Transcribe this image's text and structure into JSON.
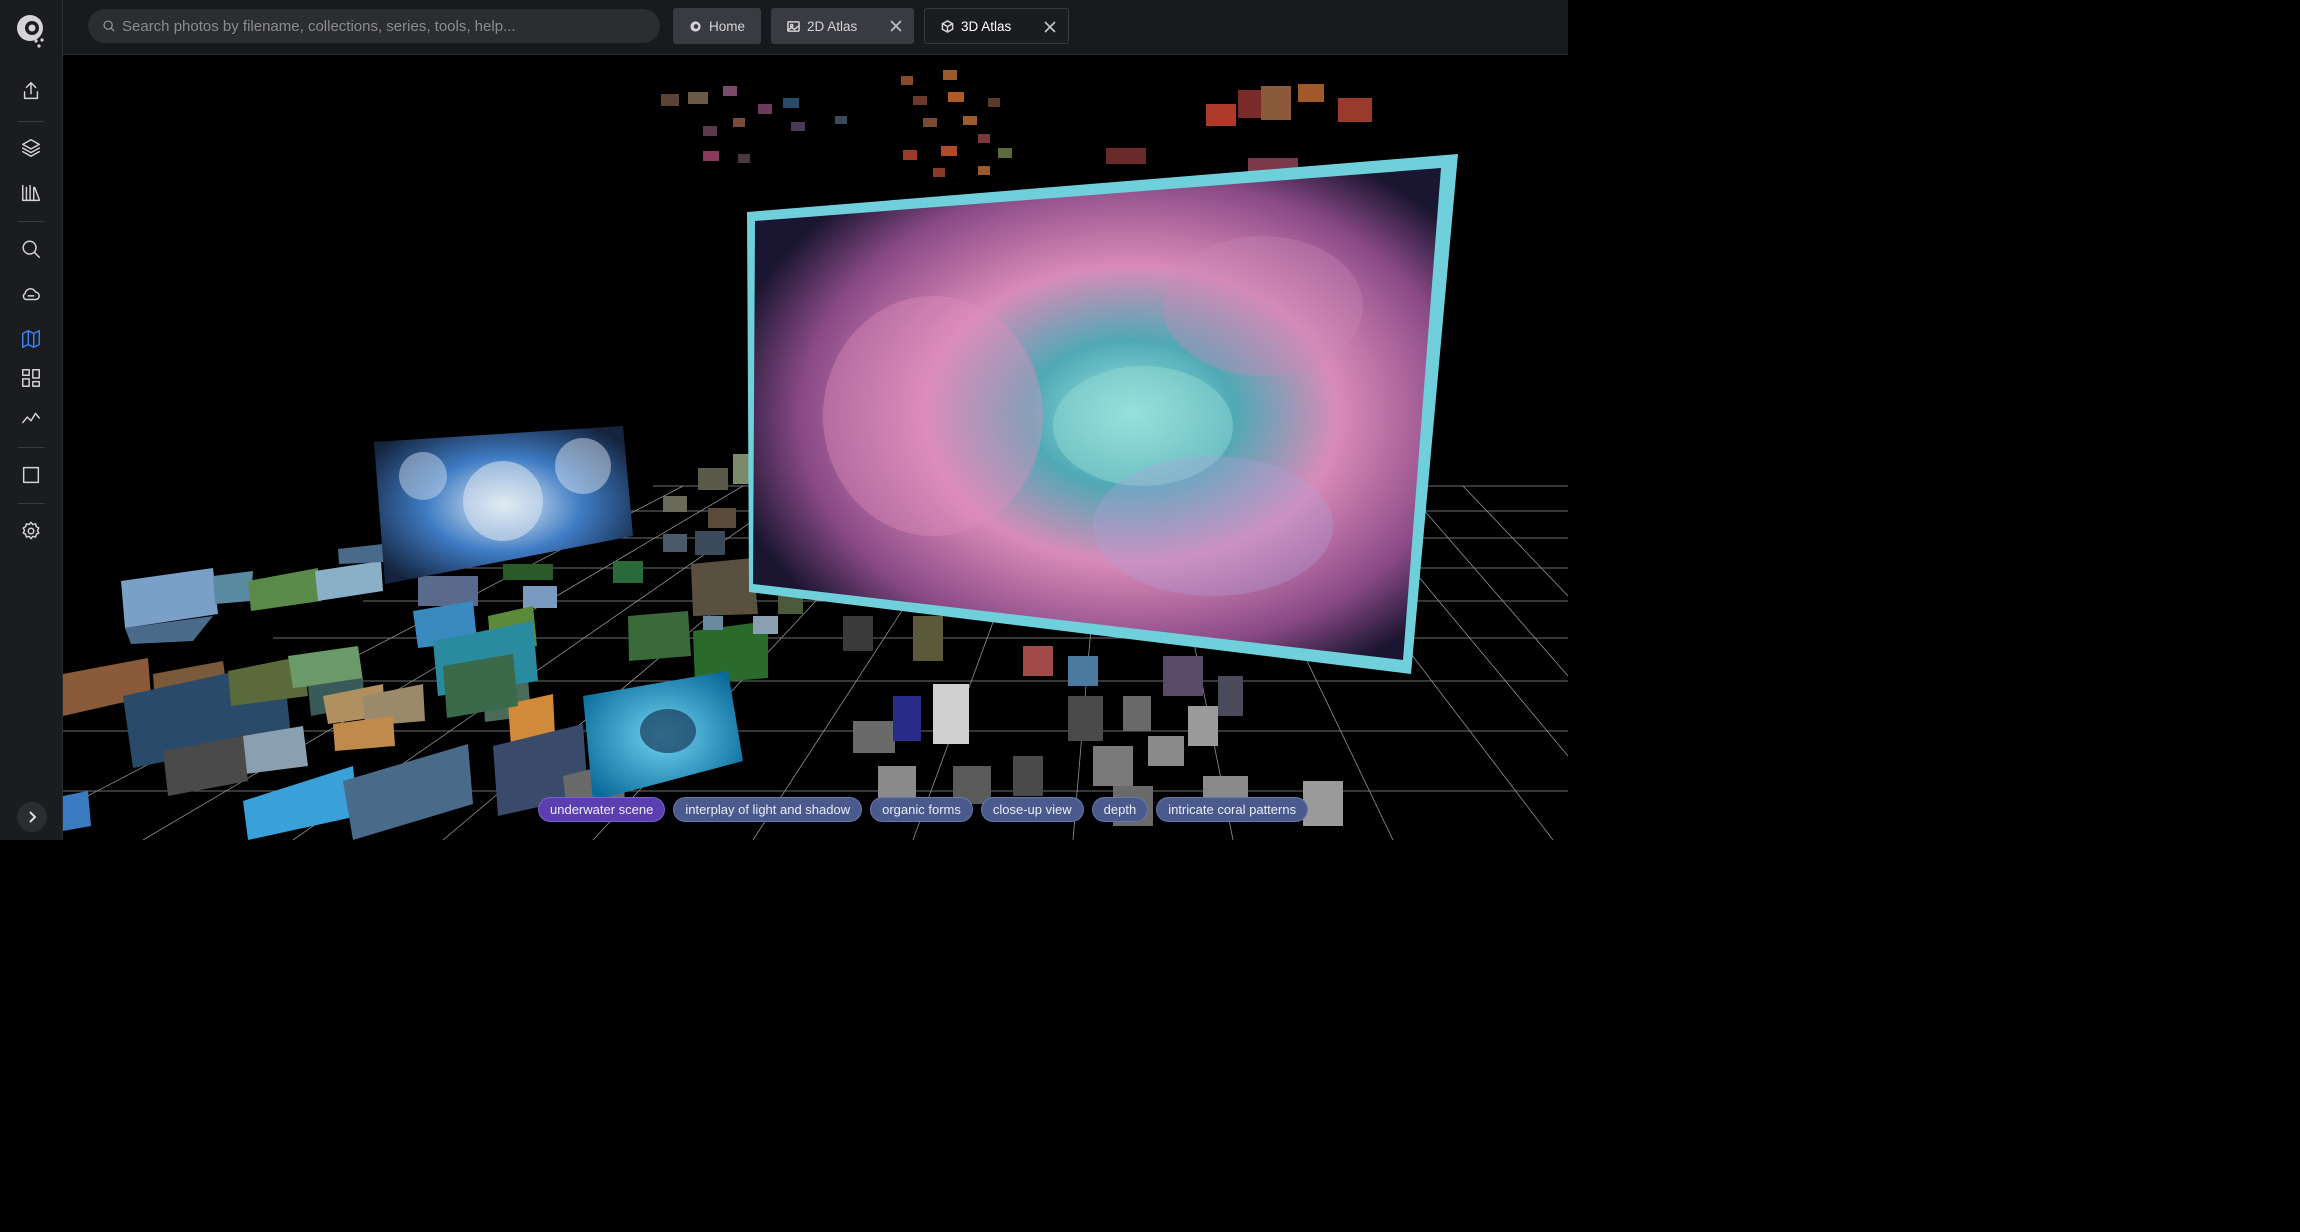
{
  "sidebar": {
    "logo": "app-logo",
    "items": [
      {
        "name": "export-icon"
      },
      {
        "name": "layers-icon"
      },
      {
        "name": "library-icon"
      },
      {
        "name": "search-icon"
      },
      {
        "name": "cloud-icon"
      },
      {
        "name": "map-icon",
        "active": true
      },
      {
        "name": "grid-icon"
      },
      {
        "name": "chart-line-icon"
      },
      {
        "name": "square-icon"
      },
      {
        "name": "gear-icon"
      }
    ],
    "expand": "chevron-right-icon"
  },
  "search": {
    "placeholder": "Search photos by filename, collections, series, tools, help..."
  },
  "tabs": [
    {
      "label": "Home",
      "icon": "logo-icon",
      "closable": false
    },
    {
      "label": "2D Atlas",
      "icon": "image-icon",
      "closable": true
    },
    {
      "label": "3D Atlas",
      "icon": "cube-icon",
      "closable": true,
      "active": true
    }
  ],
  "viewport": {
    "featured_photo": "sea anemone close-up",
    "highlight_color": "#6fd0dc"
  },
  "tags": [
    {
      "label": "underwater scene",
      "active": true
    },
    {
      "label": "interplay of light and shadow"
    },
    {
      "label": "organic forms"
    },
    {
      "label": "close-up view"
    },
    {
      "label": "depth"
    },
    {
      "label": "intricate coral patterns"
    }
  ]
}
